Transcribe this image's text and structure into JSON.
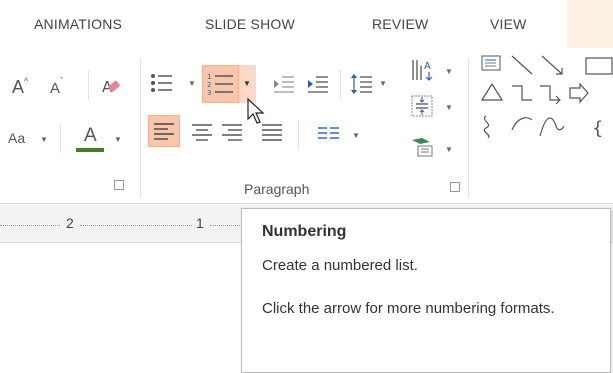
{
  "tabs": [
    {
      "label": "ANIMATIONS"
    },
    {
      "label": "SLIDE SHOW"
    },
    {
      "label": "REVIEW"
    },
    {
      "label": "VIEW"
    }
  ],
  "ribbon": {
    "font_group": {
      "grow_font": "A",
      "shrink_font": "A",
      "change_case": "Aa",
      "font_color": "A"
    },
    "paragraph_group": {
      "label": "Paragraph"
    }
  },
  "ruler": {
    "marks": [
      "2",
      "1"
    ]
  },
  "tooltip": {
    "title": "Numbering",
    "line1": "Create a numbered list.",
    "line2": "Click the arrow for more numbering formats."
  },
  "colors": {
    "active_highlight": "#f8c6ad",
    "font_color_bar": "#4a7b2a",
    "tab_highlight": "#fdf1e6"
  }
}
